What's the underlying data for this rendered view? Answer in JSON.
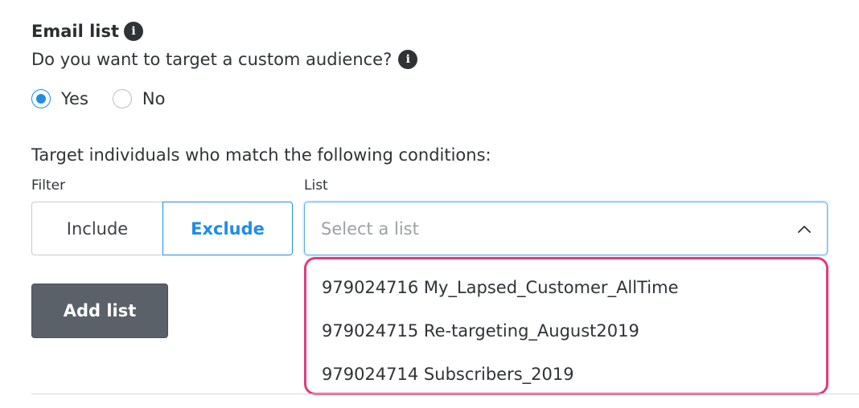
{
  "email_list": {
    "title": "Email list",
    "info_icon": "info-icon",
    "question": "Do you want to target a custom audience?",
    "radio_yes": "Yes",
    "radio_no": "No",
    "selected": "Yes"
  },
  "conditions": {
    "heading": "Target individuals who match the following conditions:",
    "filter_label": "Filter",
    "list_label": "List",
    "include_label": "Include",
    "exclude_label": "Exclude",
    "active_filter": "Exclude",
    "select_placeholder": "Select a list",
    "chevron_icon": "chevron-up-icon",
    "options": [
      "979024716 My_Lapsed_Customer_AllTime",
      "979024715 Re-targeting_August2019",
      "979024714 Subscribers_2019"
    ]
  },
  "actions": {
    "add_list_label": "Add list"
  },
  "colors": {
    "accent": "#1f8ce6",
    "highlight_border": "#df3c7d",
    "button_bg": "#5b6169"
  }
}
